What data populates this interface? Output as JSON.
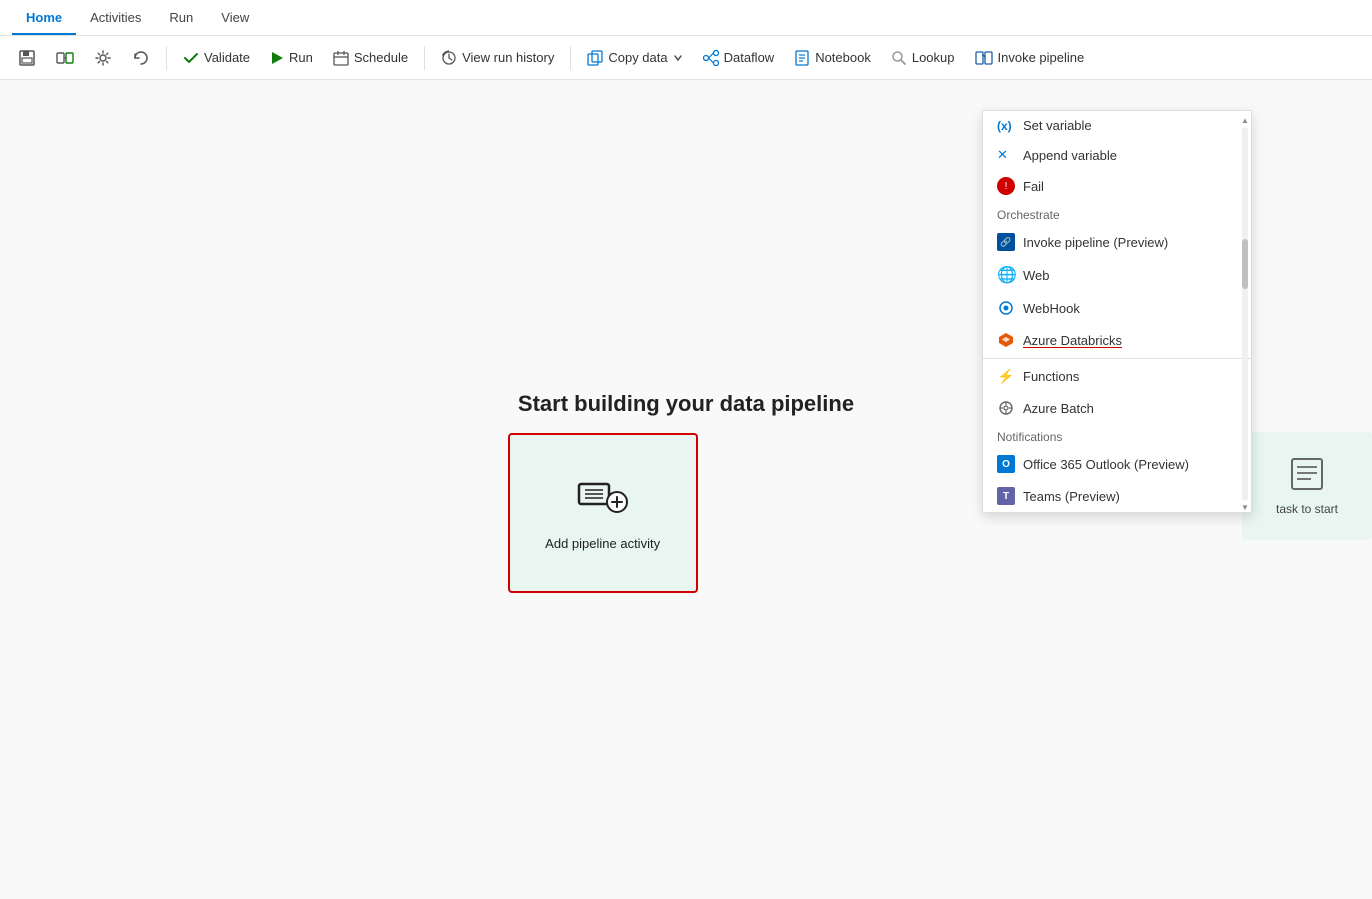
{
  "tabs": [
    {
      "label": "Home",
      "active": true
    },
    {
      "label": "Activities",
      "active": false
    },
    {
      "label": "Run",
      "active": false
    },
    {
      "label": "View",
      "active": false
    }
  ],
  "toolbar": {
    "save_label": "",
    "pipeline_label": "",
    "settings_label": "",
    "undo_label": "",
    "validate_label": "Validate",
    "run_label": "Run",
    "schedule_label": "Schedule",
    "view_run_history_label": "View run history",
    "copy_data_label": "Copy data",
    "dataflow_label": "Dataflow",
    "notebook_label": "Notebook",
    "lookup_label": "Lookup",
    "invoke_pipeline_label": "Invoke pipeline"
  },
  "canvas": {
    "title": "Start building your data pipeline",
    "add_activity_label": "Add pipeline activity"
  },
  "right_card": {
    "icon": "📋",
    "text": "task to start"
  },
  "dropdown": {
    "items": [
      {
        "type": "item",
        "label": "Set variable",
        "icon": "(x)",
        "icon_color": "#0078d4"
      },
      {
        "type": "item",
        "label": "Append variable",
        "icon": "✕",
        "icon_color": "#0078d4"
      },
      {
        "type": "item",
        "label": "Fail",
        "icon": "⚠",
        "icon_color": "#d10000",
        "has_icon_bg": true
      },
      {
        "type": "section",
        "label": "Orchestrate"
      },
      {
        "type": "item",
        "label": "Invoke pipeline (Preview)",
        "icon": "🔗",
        "icon_color": "#0050a0"
      },
      {
        "type": "item",
        "label": "Web",
        "icon": "🌐",
        "icon_color": "#0078d4"
      },
      {
        "type": "item",
        "label": "WebHook",
        "icon": "⚙",
        "icon_color": "#0078d4"
      },
      {
        "type": "item",
        "label": "Azure Databricks",
        "icon": "◆",
        "icon_color": "#e65a0e",
        "underline": true
      },
      {
        "type": "divider"
      },
      {
        "type": "item",
        "label": "Functions",
        "icon": "⚡",
        "icon_color": "#f5a623"
      },
      {
        "type": "item",
        "label": "Azure Batch",
        "icon": "⚙",
        "icon_color": "#666"
      },
      {
        "type": "section",
        "label": "Notifications"
      },
      {
        "type": "item",
        "label": "Office 365 Outlook (Preview)",
        "icon": "O",
        "icon_color": "#0078d4"
      },
      {
        "type": "item",
        "label": "Teams (Preview)",
        "icon": "T",
        "icon_color": "#6264a7"
      }
    ]
  }
}
